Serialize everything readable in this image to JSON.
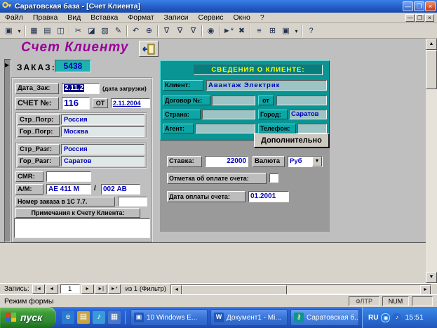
{
  "window": {
    "title": "Саратовская  база - [Счет Клиента]",
    "menu": [
      "Файл",
      "Правка",
      "Вид",
      "Вставка",
      "Формат",
      "Записи",
      "Сервис",
      "Окно",
      "?"
    ],
    "buttons": {
      "minimize": "—",
      "maximize": "❐",
      "close": "×"
    },
    "mdi": {
      "minimize": "—",
      "restore": "❐",
      "close": "×"
    }
  },
  "toolbar": {
    "icons": [
      {
        "name": "form-view",
        "glyph": "▣"
      },
      {
        "name": "form-view-dropdown",
        "glyph": "▾"
      },
      {
        "name": "save",
        "glyph": "▦"
      },
      {
        "name": "print",
        "glyph": "▤"
      },
      {
        "name": "print-preview",
        "glyph": "◫"
      },
      {
        "name": "cut",
        "glyph": "✂"
      },
      {
        "name": "copy",
        "glyph": "◪"
      },
      {
        "name": "paste",
        "glyph": "▧"
      },
      {
        "name": "format-painter",
        "glyph": "✎"
      },
      {
        "name": "undo",
        "glyph": "↶"
      },
      {
        "name": "insert-hyperlink",
        "glyph": "⊕"
      },
      {
        "name": "filter-by-selection",
        "glyph": "∇"
      },
      {
        "name": "filter-by-form",
        "glyph": "∇"
      },
      {
        "name": "apply-filter",
        "glyph": "∇"
      },
      {
        "name": "find",
        "glyph": "◉"
      },
      {
        "name": "new-record",
        "glyph": "►*"
      },
      {
        "name": "delete-record",
        "glyph": "✖"
      },
      {
        "name": "properties",
        "glyph": "≡"
      },
      {
        "name": "database-window",
        "glyph": "⊞"
      },
      {
        "name": "new-object",
        "glyph": "▣"
      },
      {
        "name": "new-object-dropdown",
        "glyph": "▾"
      },
      {
        "name": "help",
        "glyph": "?"
      }
    ]
  },
  "form": {
    "header": "Счет Клиенту",
    "order_label": "ЗАКАЗ:",
    "order_value": "5438",
    "left": {
      "date_label": "Дата_Зак:",
      "date_value": "2.11.2",
      "date_note": "(дата загрузки)",
      "invoice_label": "СЧЕТ  №:",
      "invoice_value": "116",
      "ot_label": "ОТ",
      "invoice_date": "2.11.2004",
      "str_pogr_label": "Стр_Погр:",
      "str_pogr_value": "Россия",
      "gor_pogr_label": "Гор_Погр:",
      "gor_pogr_value": "Москва",
      "str_razg_label": "Стр_Разг:",
      "str_razg_value": "Россия",
      "gor_razg_label": "Гор_Разг:",
      "gor_razg_value": "Саратов",
      "cmr_label": "CMR:",
      "cmr_value": "",
      "am_label": "А/М:",
      "am_value1": "АЕ 411 М",
      "am_sep": "/",
      "am_value2": "002 АВ",
      "order_1c_label": "Номер заказа в 1С 7.7.",
      "order_1c_value": "",
      "notes_label": "Примечания к Счету Клиента:",
      "notes_value": ""
    },
    "client": {
      "header": "СВЕДЕНИЯ О КЛИЕНТЕ:",
      "client_label": "Клиент:",
      "client_value": "Авантаж Электрик",
      "contract_label": "Договор №:",
      "contract_value": "",
      "ot_label": "от",
      "contract_date": "",
      "country_label": "Страна:",
      "country_value": "",
      "city_label": "Город:",
      "city_value": "Саратов",
      "agent_label": "Агент:",
      "agent_value": "",
      "phone_label": "Телефон:",
      "phone_value": "",
      "more_button": "Дополнительно"
    },
    "payment": {
      "rate_label": "Ставка:",
      "rate_value": "22000",
      "currency_label": "Валюта",
      "currency_value": "Руб",
      "paid_label": "Отметка об оплате счета:",
      "pay_date_label": "Дата оплаты счета:",
      "pay_date_value": "01.2001"
    }
  },
  "record_nav": {
    "label": "Запись:",
    "first": "|◄",
    "prev": "◄",
    "current": "1",
    "next": "►",
    "last": "►|",
    "new": "►*",
    "of_text": "из 1 (Фильтр)"
  },
  "status_bar": {
    "mode": "Режим формы",
    "fltr": "ФЛТР",
    "num": "NUM"
  },
  "taskbar": {
    "start": "пуск",
    "tasks": [
      "10 Windows E...",
      "Документ1 - Mi...",
      "Саратовская  б..."
    ],
    "tray": {
      "lang": "RU",
      "time": "15:51"
    }
  }
}
